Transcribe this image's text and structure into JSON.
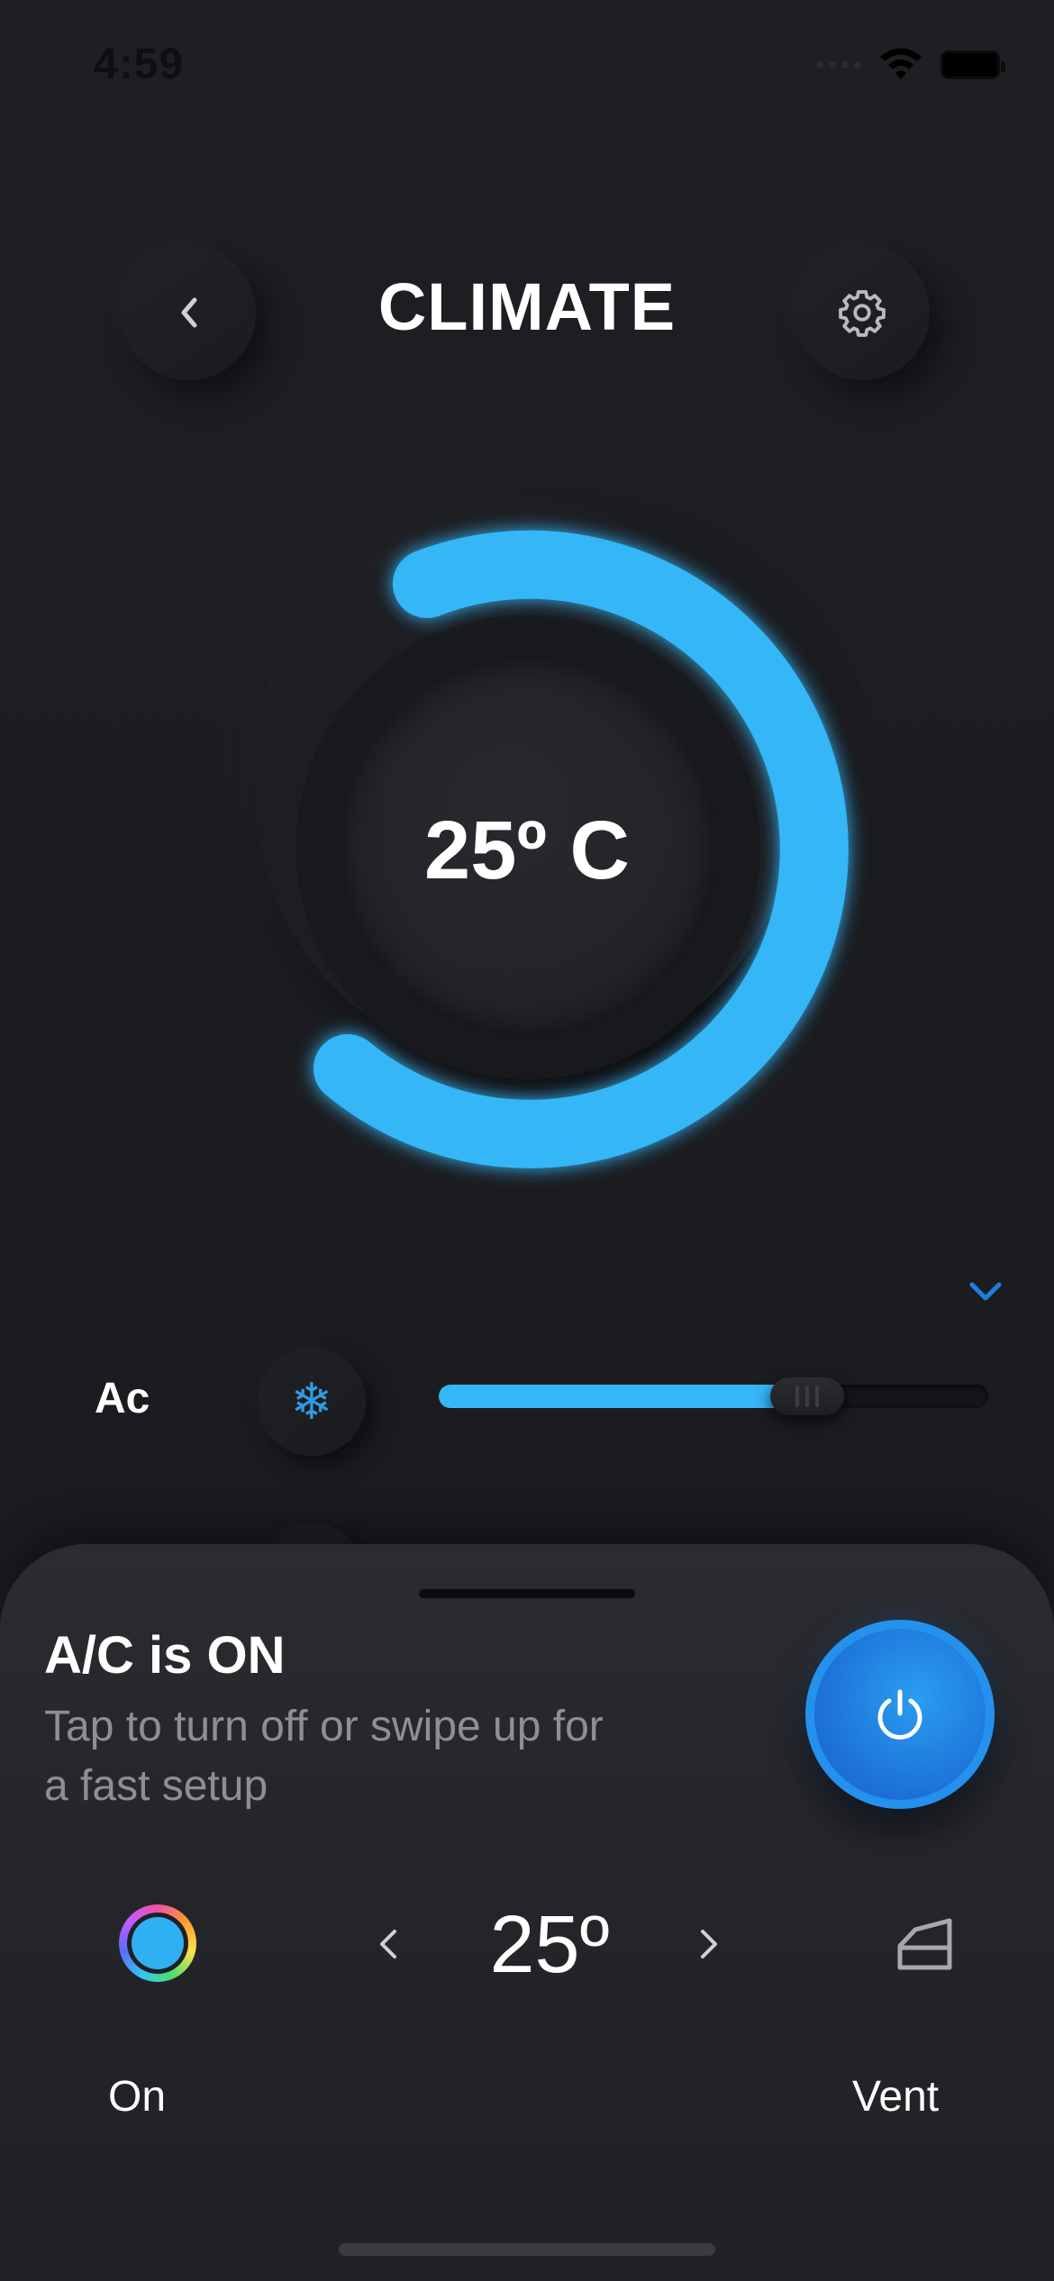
{
  "status_bar": {
    "time": "4:59",
    "icons": [
      "signal-icon",
      "wifi-icon",
      "battery-icon"
    ]
  },
  "header": {
    "title": "CLIMATE",
    "back_icon": "chevron-left-icon",
    "settings_icon": "gear-icon"
  },
  "dial": {
    "temperature_text": "25º C",
    "accent_color": "#35b6f7"
  },
  "ac_row": {
    "label": "Ac",
    "icon": "snowflake-icon",
    "level": 0.67
  },
  "sheet": {
    "title": "A/C is ON",
    "subtitle": "Tap to turn off or swipe up for a fast setup",
    "power_icon": "power-icon",
    "temperature": "25º",
    "left_label": "On",
    "right_label": "Vent",
    "power_color": "#1f7ee0"
  },
  "colors": {
    "background": "#1c1d21",
    "accent": "#35b6f7",
    "power": "#1f7ee0"
  }
}
